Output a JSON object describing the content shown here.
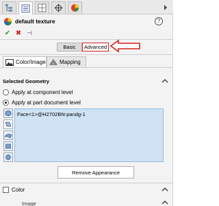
{
  "header": {
    "title": "default texture",
    "help_glyph": "?"
  },
  "tabs": [
    {
      "name": "feature-manager",
      "icon": "tree-icon"
    },
    {
      "name": "property-manager",
      "icon": "list-icon"
    },
    {
      "name": "configuration-manager",
      "icon": "config-icon"
    },
    {
      "name": "dimxpert",
      "icon": "crosshair-icon"
    },
    {
      "name": "display-manager",
      "icon": "pie-icon"
    }
  ],
  "actions": {
    "ok_glyph": "✔",
    "cancel_glyph": "✖",
    "pin_glyph": "⊣"
  },
  "mode": {
    "basic_label": "Basic",
    "advanced_label": "Advanced",
    "selected": "Advanced"
  },
  "subtabs": {
    "color_image_label": "Color/Image",
    "mapping_label": "Mapping"
  },
  "geometry": {
    "group_title": "Selected Geometry",
    "option_component": "Apply at component level",
    "option_part": "Apply at part document level",
    "selected_option": "part",
    "selection_item": "Face<1>@H2702BN-pandg-1",
    "remove_button": "Remove Appearance"
  },
  "color_section": {
    "label": "Color"
  },
  "image_section": {
    "label": "Image"
  },
  "colors": {
    "highlight_red": "#d41f1f",
    "selection_blue": "#cfe3f5",
    "ok_green": "#2e9a2e",
    "cancel_red": "#d02020"
  }
}
